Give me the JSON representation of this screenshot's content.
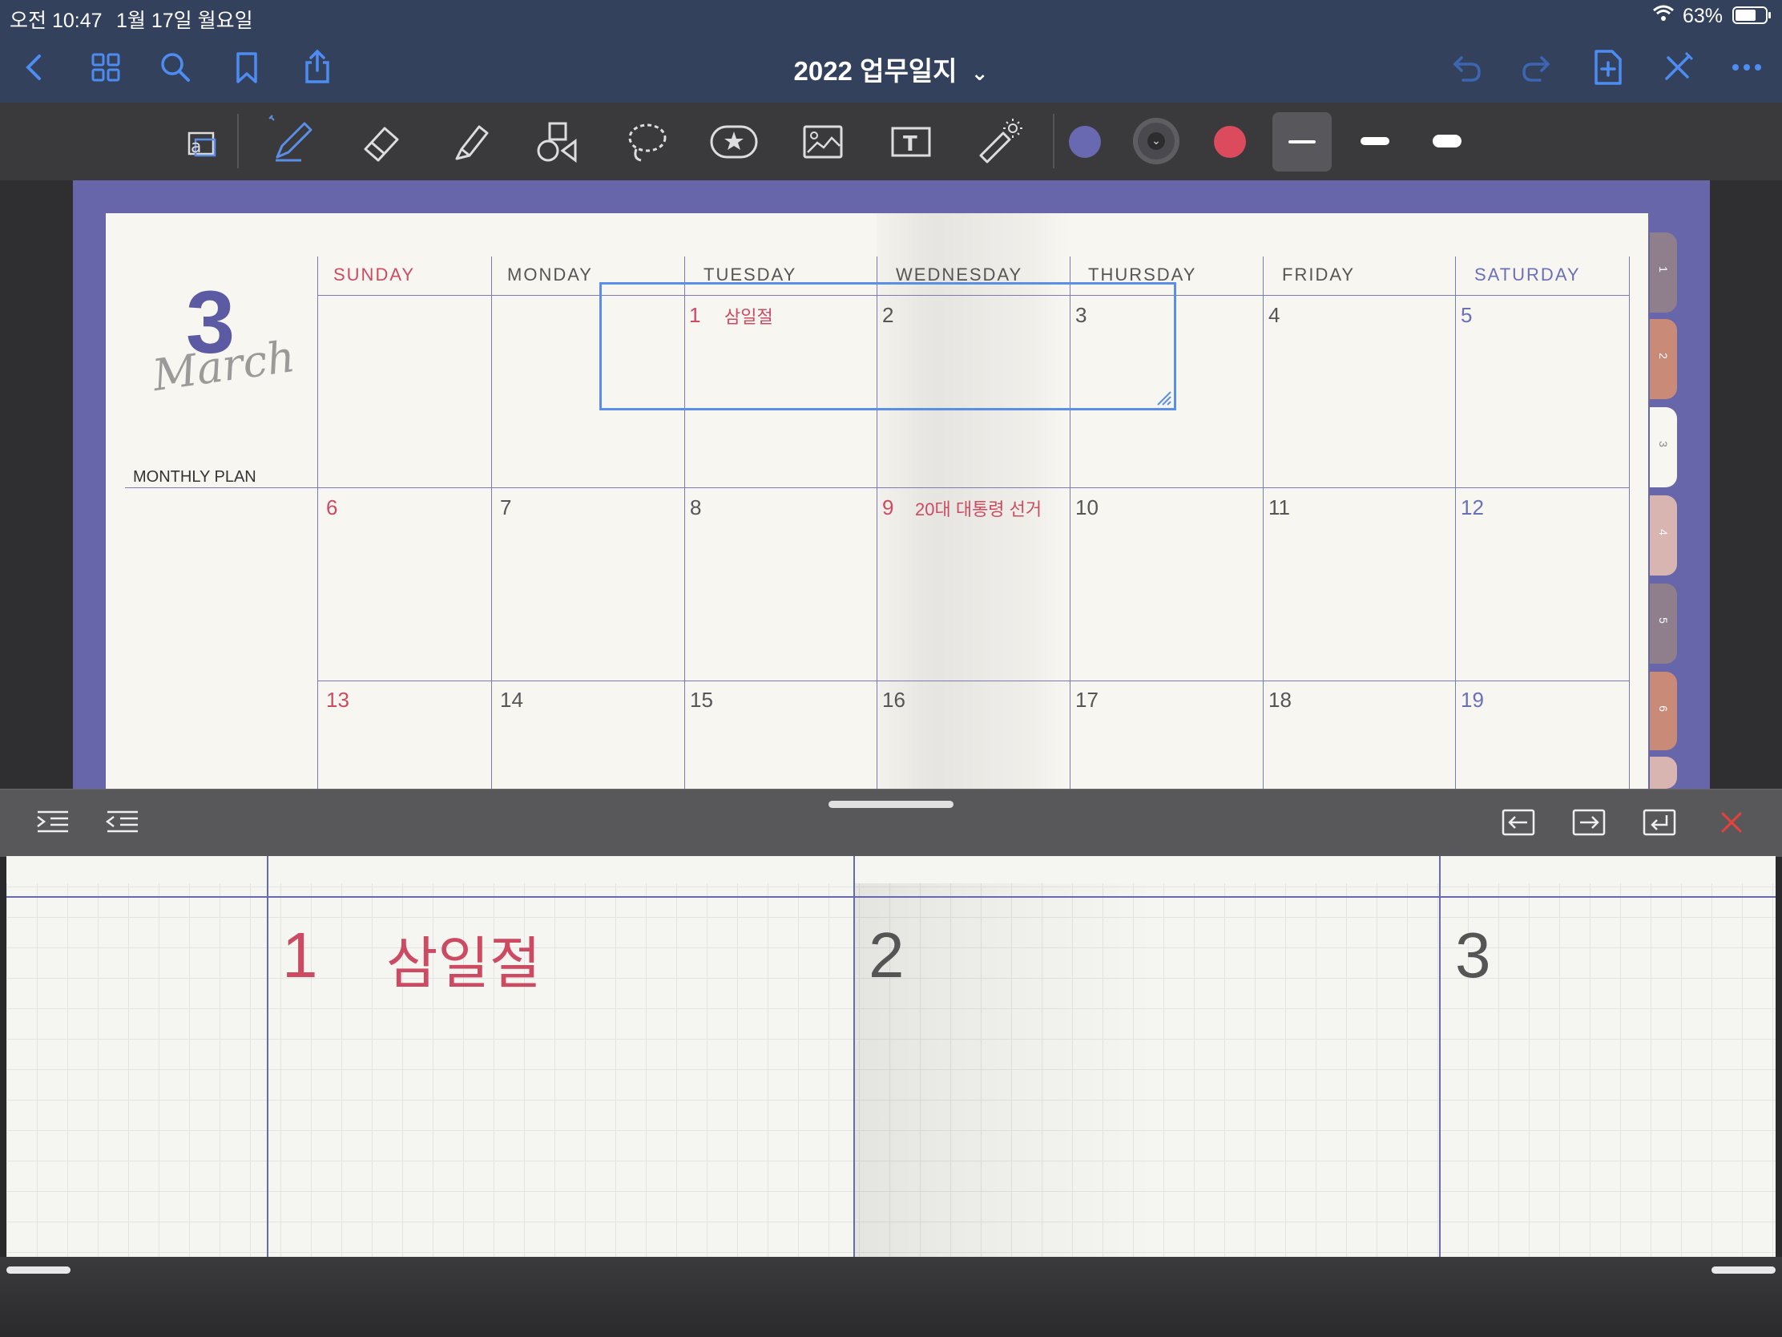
{
  "status_bar": {
    "time": "오전 10:47",
    "date": "1월 17일 월요일",
    "battery": "63%"
  },
  "nav": {
    "title": "2022 업무일지",
    "title_chevron": "⌄"
  },
  "toolbar": {
    "tools": [
      "layout-icon",
      "pen-icon",
      "eraser-icon",
      "highlighter-icon",
      "shapes-icon",
      "lasso-icon",
      "sticker-icon",
      "image-icon",
      "text-icon",
      "laser-pointer-icon"
    ],
    "colors": [
      "#6869b0",
      "#55555a",
      "#dc4a5e"
    ],
    "selected_color": "#6869b0",
    "color_picker_glyph": "⌄"
  },
  "planner": {
    "month_number": "3",
    "month_script": "March",
    "section_label": "MONTHLY PLAN",
    "day_headers": [
      "SUNDAY",
      "MONDAY",
      "TUESDAY",
      "WEDNESDAY",
      "THURSDAY",
      "FRIDAY",
      "SATURDAY"
    ],
    "weeks": [
      [
        "",
        "",
        "1",
        "2",
        "3",
        "4",
        "5"
      ],
      [
        "6",
        "7",
        "8",
        "9",
        "10",
        "11",
        "12"
      ],
      [
        "13",
        "14",
        "15",
        "16",
        "17",
        "18",
        "19"
      ]
    ],
    "events": {
      "holiday_1": "삼일절",
      "election_9": "20대 대통령 선거"
    },
    "tabs": [
      "1",
      "2",
      "3",
      "4",
      "5",
      "6"
    ]
  },
  "zoom": {
    "cells": [
      {
        "num": "1",
        "event": "삼일절"
      },
      {
        "num": "2",
        "event": ""
      },
      {
        "num": "3",
        "event": ""
      }
    ]
  }
}
